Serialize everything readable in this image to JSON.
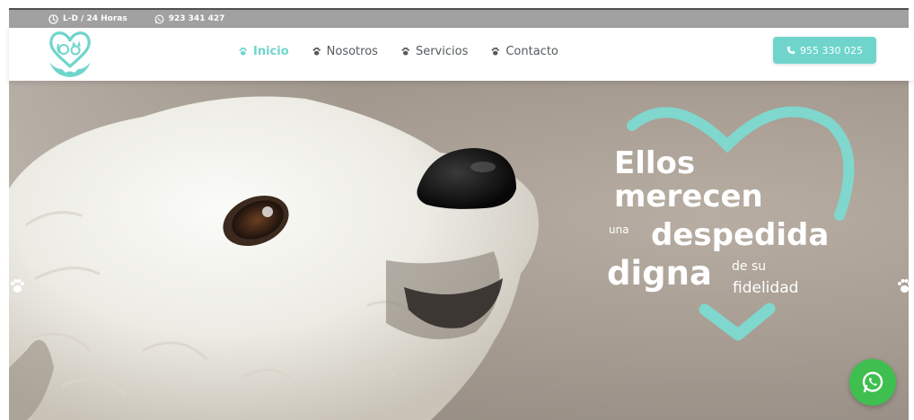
{
  "topbar": {
    "hours": "L-D / 24 Horas",
    "whatsapp_number": "923 341 427"
  },
  "nav": {
    "items": [
      {
        "label": "Inicio",
        "active": true
      },
      {
        "label": "Nosotros",
        "active": false
      },
      {
        "label": "Servicios",
        "active": false
      },
      {
        "label": "Contacto",
        "active": false
      }
    ]
  },
  "cta": {
    "phone": "955 330 025"
  },
  "hero": {
    "line1": "Ellos",
    "line2": "merecen",
    "line3a": "una",
    "line3b": "despedida",
    "line4a": "digna",
    "line4b": "de su",
    "line5": "fidelidad"
  },
  "colors": {
    "accent": "#6fd5cc",
    "topbar": "#a1a1a1",
    "nav_text": "#555a5e",
    "whatsapp": "#3fbf4f"
  },
  "icons": {
    "hours": "clock-icon",
    "whatsapp_small": "whatsapp-icon",
    "nav": "paw-icon",
    "cta": "phone-icon",
    "slider_prev": "paw-icon",
    "slider_next": "paw-icon",
    "float": "whatsapp-icon"
  }
}
